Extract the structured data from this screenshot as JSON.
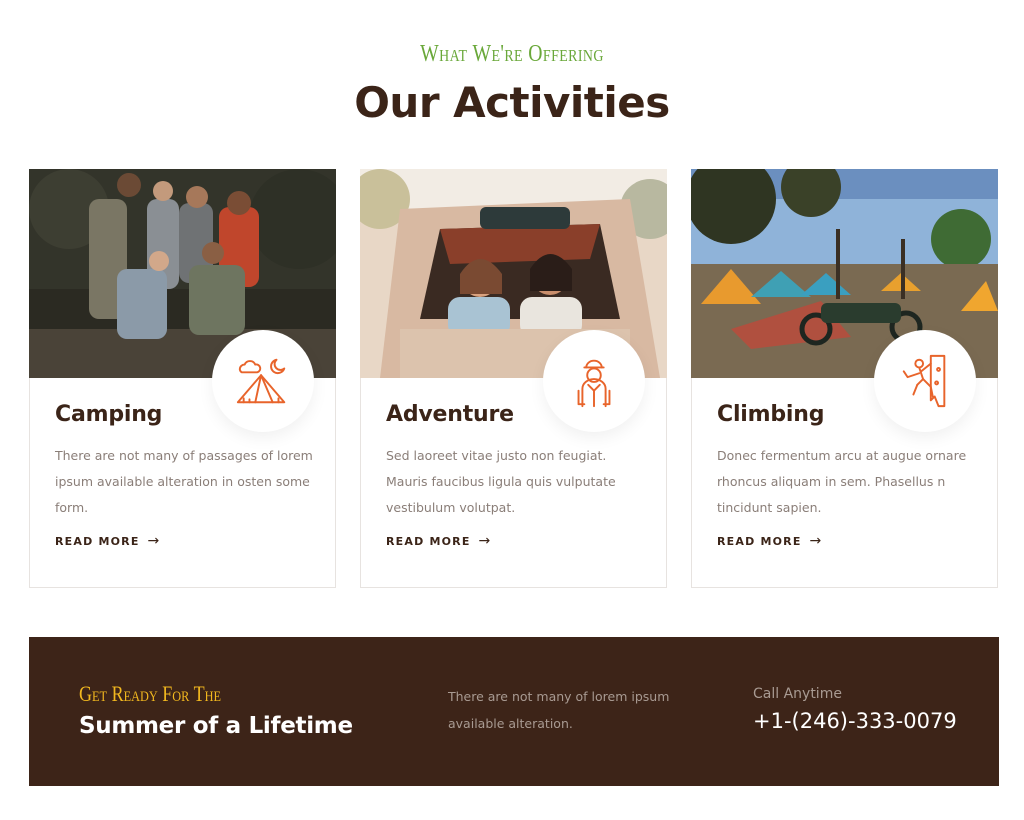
{
  "header": {
    "eyebrow": "What We're Offering",
    "title": "Our Activities"
  },
  "cards": [
    {
      "title": "Camping",
      "text": "There are not many of passages of lorem ipsum available alteration in osten some form.",
      "link": "READ MORE",
      "icon": "camping-tent-icon"
    },
    {
      "title": "Adventure",
      "text": "Sed laoreet vitae justo non feugiat. Mauris faucibus ligula quis vulputate vestibulum volutpat.",
      "link": "READ MORE",
      "icon": "hiker-icon"
    },
    {
      "title": "Climbing",
      "text": "Donec fermentum arcu at augue ornare rhoncus aliquam in sem. Phasellus n tincidunt sapien.",
      "link": "READ MORE",
      "icon": "climbing-wall-icon"
    }
  ],
  "banner": {
    "eyebrow": "Get Ready For The",
    "title": "Summer of a Lifetime",
    "text": "There are not many of lorem ipsum available alteration.",
    "call_label": "Call Anytime",
    "phone": "+1-(246)-333-0079"
  },
  "colors": {
    "brown": "#3d2418",
    "green": "#6aa83a",
    "orange": "#e8642b",
    "yellow": "#f2b81f"
  }
}
